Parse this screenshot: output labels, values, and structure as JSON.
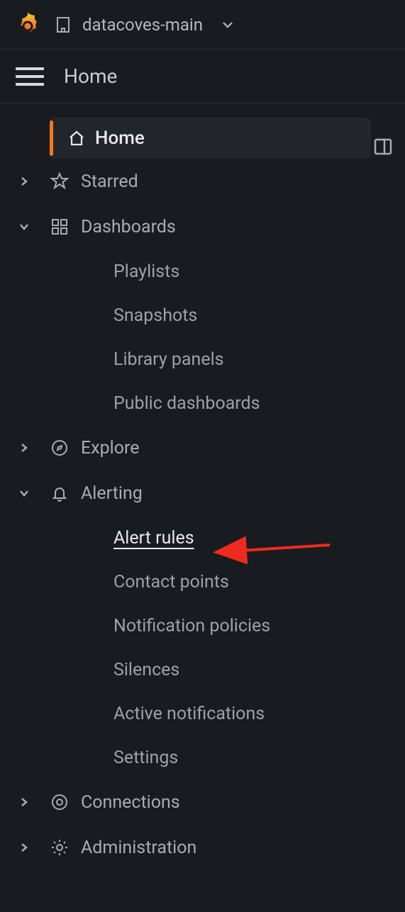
{
  "topbar": {
    "org_name": "datacoves-main"
  },
  "breadcrumb": {
    "title": "Home"
  },
  "nav": {
    "home": "Home",
    "starred": "Starred",
    "dashboards": "Dashboards",
    "dashboards_sub": {
      "playlists": "Playlists",
      "snapshots": "Snapshots",
      "library_panels": "Library panels",
      "public_dashboards": "Public dashboards"
    },
    "explore": "Explore",
    "alerting": "Alerting",
    "alerting_sub": {
      "alert_rules": "Alert rules",
      "contact_points": "Contact points",
      "notification_policies": "Notification policies",
      "silences": "Silences",
      "active_notifications": "Active notifications",
      "settings": "Settings"
    },
    "connections": "Connections",
    "administration": "Administration"
  }
}
